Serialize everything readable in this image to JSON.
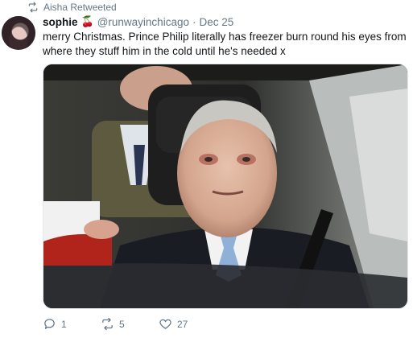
{
  "retweet_context": {
    "label": "Aisha Retweeted",
    "icon": "retweet-icon"
  },
  "tweet": {
    "author_name": "sophie",
    "author_emoji": "🍒",
    "handle": "@runwayinchicago",
    "separator": "·",
    "date": "Dec 25",
    "text": "merry Christmas. Prince Philip literally has freezer burn round his eyes from where they stuff him in the cold until he's needed x",
    "media": {
      "type": "photo"
    },
    "counts": {
      "replies": "1",
      "retweets": "5",
      "likes": "27"
    }
  },
  "icons": {
    "reply": "reply-icon",
    "retweet": "retweet-icon",
    "like": "heart-icon"
  },
  "colors": {
    "muted": "#657786",
    "text": "#14171a",
    "border": "#e1e8ed"
  }
}
